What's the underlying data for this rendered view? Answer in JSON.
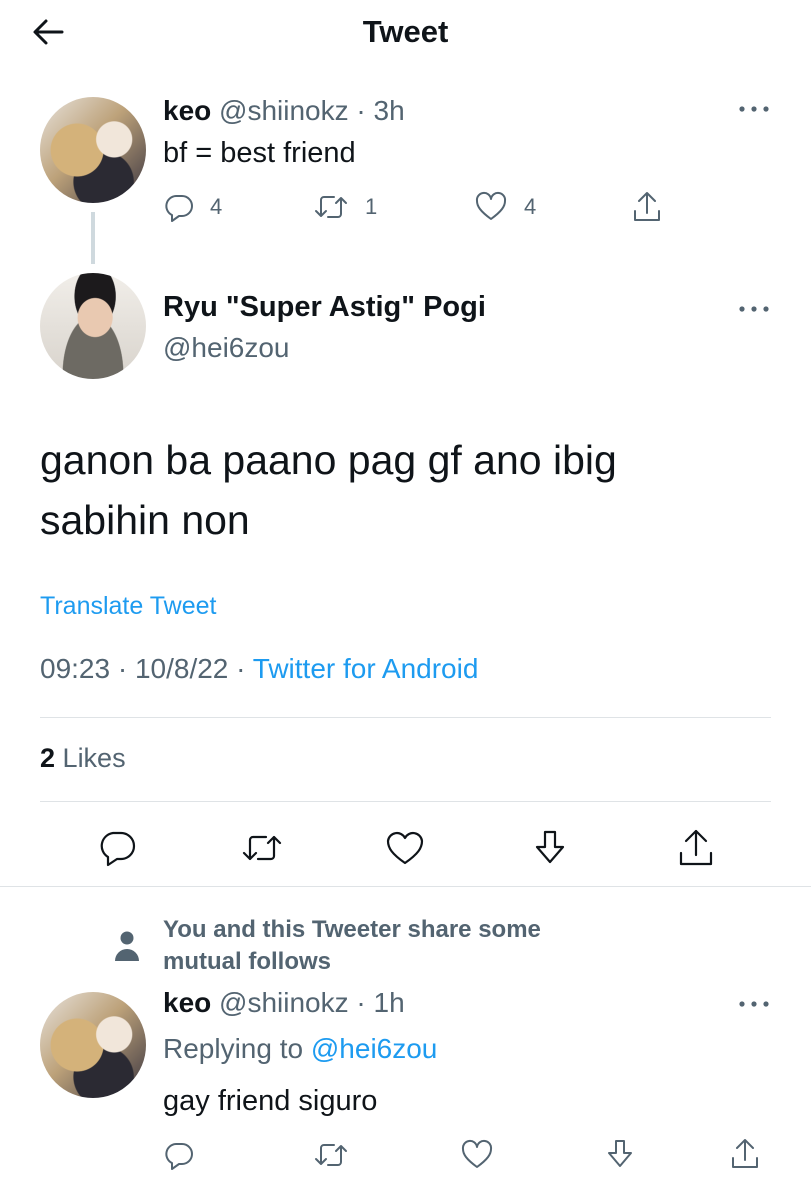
{
  "header": {
    "title": "Tweet"
  },
  "parent_tweet": {
    "name": "keo",
    "handle": "@shiinokz",
    "time": "· 3h",
    "text": "bf = best friend",
    "replies": "4",
    "retweets": "1",
    "likes": "4"
  },
  "main_tweet": {
    "name": "Ryu \"Super Astig\" Pogi",
    "handle": "@hei6zou",
    "text_line1": "ganon ba paano pag gf ano ibig",
    "text_line2": "sabihin non",
    "translate": "Translate Tweet",
    "time": "09:23 · 10/8/22 ·",
    "source": "Twitter for Android",
    "likes_count": "2",
    "likes_label": "Likes"
  },
  "mutual_notice": {
    "line1": "You and this Tweeter share some",
    "line2": "mutual follows"
  },
  "reply_tweet": {
    "name": "keo",
    "handle": "@shiinokz",
    "time": "· 1h",
    "replying_prefix": "Replying to",
    "replying_to": "@hei6zou",
    "text": "gay friend siguro"
  },
  "icons": {
    "back": "arrow-left-icon",
    "more": "more-dots-icon",
    "reply": "reply-bubble-icon",
    "retweet": "retweet-icon",
    "like": "heart-icon",
    "share": "share-icon",
    "bookmark": "download-arrow-icon",
    "person": "person-icon"
  },
  "colors": {
    "accent": "#1d9bf0",
    "muted": "#536471",
    "text": "#0f1419"
  }
}
